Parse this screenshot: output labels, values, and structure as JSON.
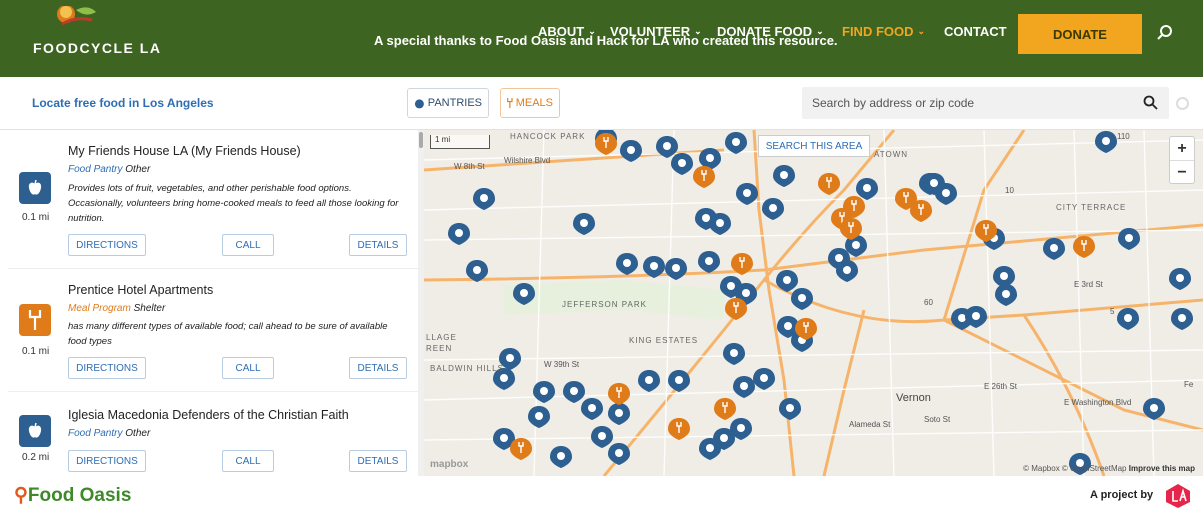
{
  "header": {
    "logo_text": "FOODCYCLE LA",
    "thanks": "A special thanks to Food Oasis and Hack for LA who created this resource.",
    "nav": [
      {
        "label": "ABOUT",
        "chevron": "⌄"
      },
      {
        "label": "VOLUNTEER",
        "chevron": "⌄"
      },
      {
        "label": "DONATE FOOD",
        "chevron": "⌄"
      },
      {
        "label": "FIND FOOD",
        "chevron": "⌄"
      },
      {
        "label": "CONTACT"
      }
    ],
    "donate": "DONATE",
    "search_icon": "search-icon",
    "colors": {
      "green": "#3e6421",
      "orange": "#f2a51f"
    }
  },
  "toolbar": {
    "locate": "Locate free food in Los Angeles",
    "pantries": "PANTRIES",
    "meals": "MEALS",
    "search_placeholder": "Search by address or zip code"
  },
  "list": [
    {
      "name": "My Friends House LA (My Friends House)",
      "type": "pantry",
      "category": "Food Pantry",
      "tag": "Other",
      "description": "Provides lots of fruit, vegetables, and other perishable food options. Occasionally, volunteers bring home-cooked meals to feed all those looking for nutrition.",
      "distance": "0.1 mi",
      "actions": {
        "directions": "DIRECTIONS",
        "call": "CALL",
        "details": "DETAILS"
      }
    },
    {
      "name": "Prentice Hotel Apartments",
      "type": "meal",
      "category": "Meal Program",
      "tag": "Shelter",
      "description": "has many different types of available food; call ahead to be sure of available food types",
      "distance": "0.1 mi",
      "actions": {
        "directions": "DIRECTIONS",
        "call": "CALL",
        "details": "DETAILS"
      }
    },
    {
      "name": "Iglesia Macedonia Defenders of the Christian Faith",
      "type": "pantry",
      "category": "Food Pantry",
      "tag": "Other",
      "description": "",
      "distance": "0.2 mi",
      "actions": {
        "directions": "DIRECTIONS",
        "call": "CALL",
        "details": "DETAILS"
      }
    }
  ],
  "map": {
    "search_area": "SEARCH THIS AREA",
    "zoom_in": "+",
    "zoom_out": "−",
    "scale": "1 mi",
    "labels": {
      "hancock": "HANCOCK PARK",
      "w8th": "W 8th St",
      "wilshire": "Wilshire Blvd",
      "downtown": "ATOWN",
      "city_terrace": "CITY TERRACE",
      "e3rd": "E 3rd St",
      "jefferson": "JEFFERSON PARK",
      "llage": "LLAGE",
      "reen": "REEN",
      "king": "KING ESTATES",
      "w39th": "W 39th St",
      "baldwin": "BALDWIN HILLS",
      "vernon": "Vernon",
      "e26th": "E 26th St",
      "ewash": "E Washington Blvd",
      "alameda": "Alameda St",
      "soto": "Soto St",
      "fe": "Fe",
      "r110": "110",
      "r10": "10",
      "r60": "60",
      "r5": "5"
    },
    "logo": "mapbox",
    "attribution": "© Mapbox © OpenStreetMap",
    "improve": "Improve this map",
    "pin_colors": {
      "pantry": "#2d5f91",
      "meal": "#e07b1a"
    }
  },
  "footer": {
    "brand": "Food Oasis",
    "project": "A project by"
  }
}
